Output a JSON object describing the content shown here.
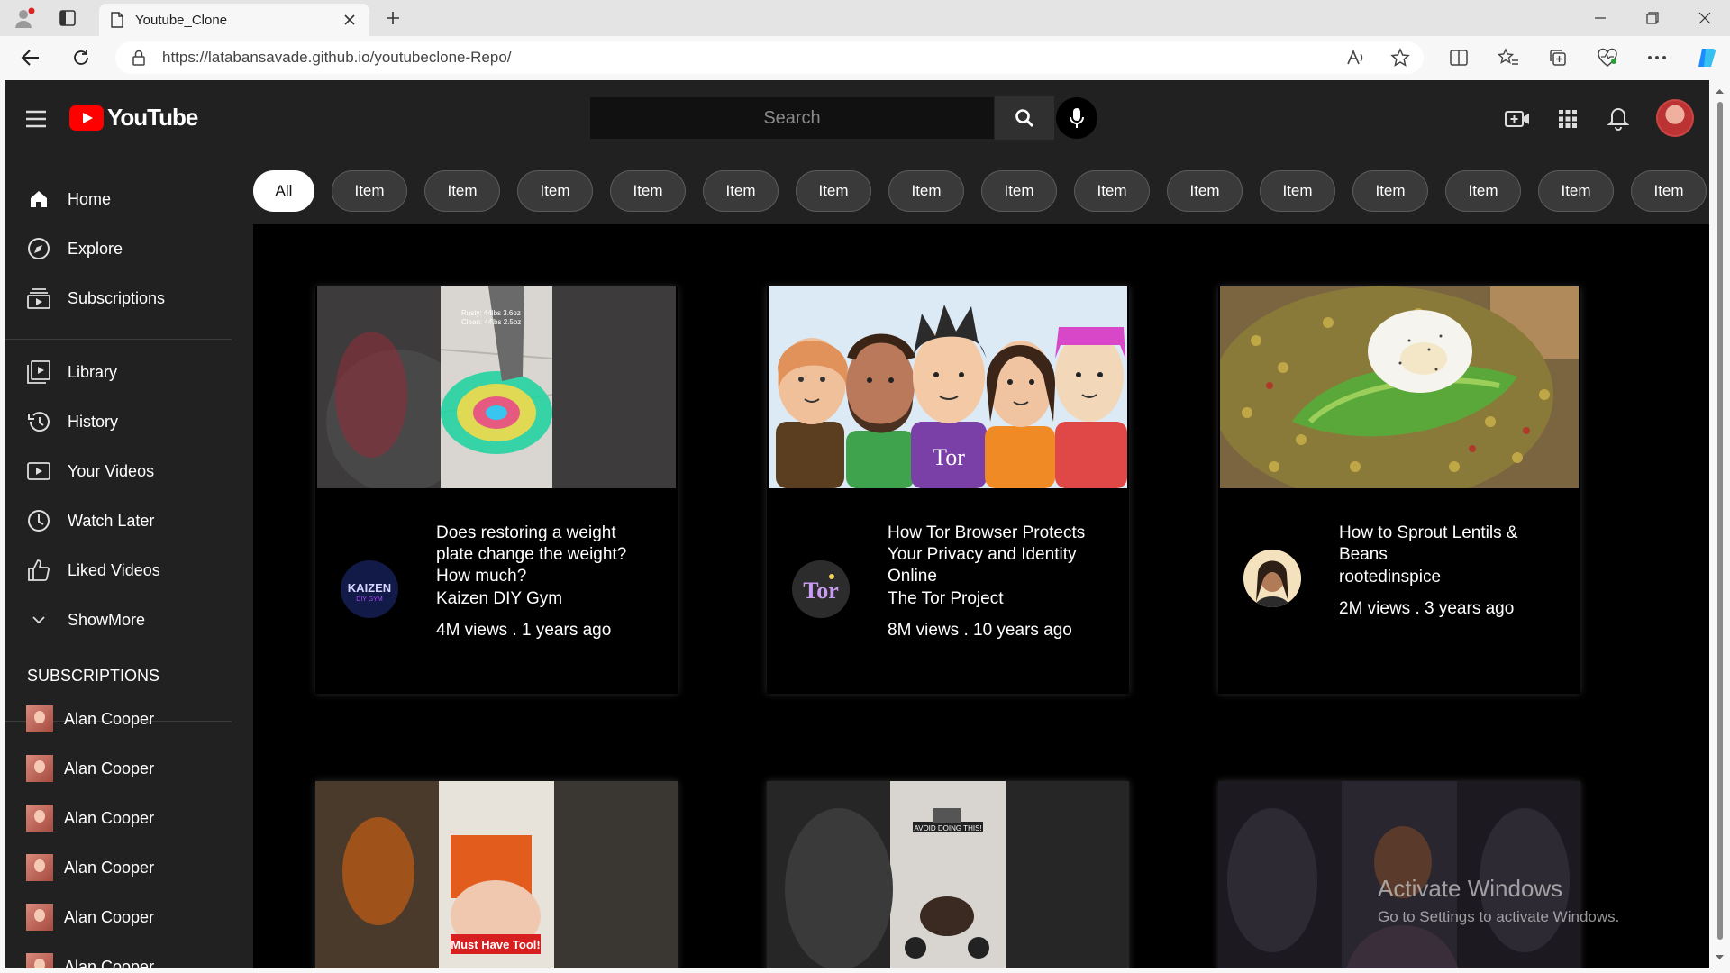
{
  "browser": {
    "tab_title": "Youtube_Clone",
    "url": "https://latabansavade.github.io/youtubeclone-Repo/"
  },
  "header": {
    "logo_text": "YouTube",
    "search_placeholder": "Search"
  },
  "sidebar": {
    "main": [
      {
        "label": "Home",
        "icon": "home-icon"
      },
      {
        "label": "Explore",
        "icon": "compass-icon"
      },
      {
        "label": "Subscriptions",
        "icon": "subscriptions-icon"
      }
    ],
    "library": [
      {
        "label": "Library",
        "icon": "library-icon"
      },
      {
        "label": "History",
        "icon": "history-icon"
      },
      {
        "label": "Your Videos",
        "icon": "your-videos-icon"
      },
      {
        "label": "Watch Later",
        "icon": "clock-icon"
      },
      {
        "label": "Liked Videos",
        "icon": "thumbs-up-icon"
      },
      {
        "label": "ShowMore",
        "icon": "chevron-down-icon"
      }
    ],
    "subscriptions_title": "SUBSCRIPTIONS",
    "subscriptions": [
      "Alan Cooper",
      "Alan Cooper",
      "Alan Cooper",
      "Alan Cooper",
      "Alan Cooper",
      "Alan Cooper"
    ]
  },
  "chips": [
    "All",
    "Item",
    "Item",
    "Item",
    "Item",
    "Item",
    "Item",
    "Item",
    "Item",
    "Item",
    "Item",
    "Item",
    "Item",
    "Item",
    "Item",
    "Item"
  ],
  "videos": [
    {
      "title": "Does restoring a weight plate change the weight? How much?",
      "channel": "Kaizen DIY Gym",
      "stats": "4M views . 1 years ago",
      "thumb_overlay": "Rusty: 44lbs 3.6oz\nClean: 44lbs 2.5oz",
      "avatar_text": "KAIZEN"
    },
    {
      "title": "How Tor Browser Protects Your Privacy and Identity Online",
      "channel": "The Tor Project",
      "stats": "8M views . 10 years ago",
      "avatar_text": "Tor"
    },
    {
      "title": "How to Sprout Lentils & Beans",
      "channel": "rootedinspice",
      "stats": "2M views . 3 years ago"
    }
  ],
  "bottom_thumbs": [
    {
      "caption": "Must Have Tool!"
    },
    {
      "caption": "AVOID DOING THIS!"
    },
    {
      "caption": ""
    }
  ],
  "watermark": {
    "line1": "Activate Windows",
    "line2": "Go to Settings to activate Windows."
  },
  "colors": {
    "yt_red": "#ff0000",
    "header_bg": "#212121",
    "page_bg": "#000000"
  }
}
